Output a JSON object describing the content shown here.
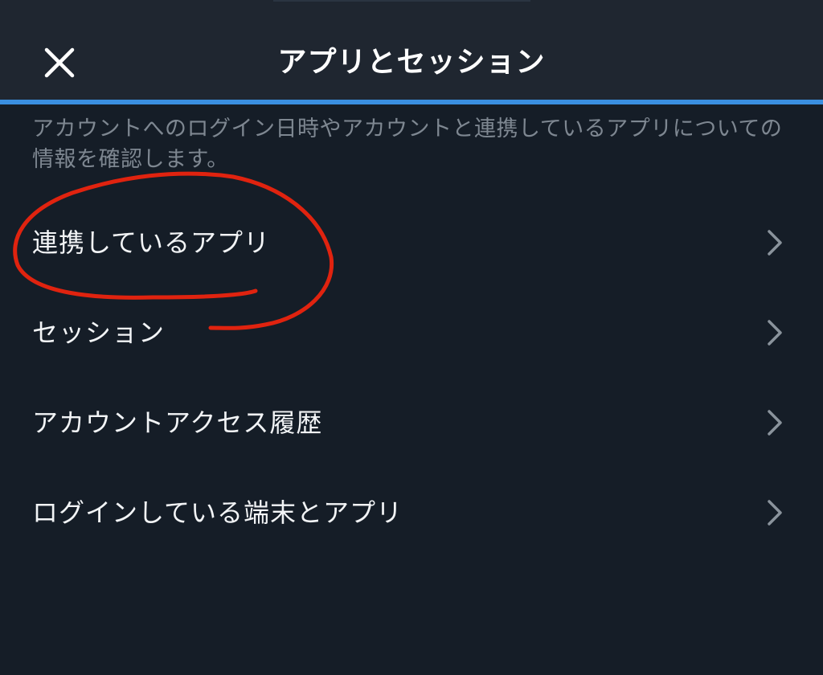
{
  "header": {
    "title": "アプリとセッション",
    "close_icon": "close-icon"
  },
  "description": "アカウントへのログイン日時やアカウントと連携しているアプリについての情報を確認します。",
  "menu": {
    "items": [
      {
        "label": "連携しているアプリ",
        "icon": "chevron-right-icon"
      },
      {
        "label": "セッション",
        "icon": "chevron-right-icon"
      },
      {
        "label": "アカウントアクセス履歴",
        "icon": "chevron-right-icon"
      },
      {
        "label": "ログインしている端末とアプリ",
        "icon": "chevron-right-icon"
      }
    ]
  },
  "colors": {
    "background": "#151d27",
    "header_background": "#1f2630",
    "accent": "#3a8fe0",
    "annotation": "#e0230f"
  }
}
